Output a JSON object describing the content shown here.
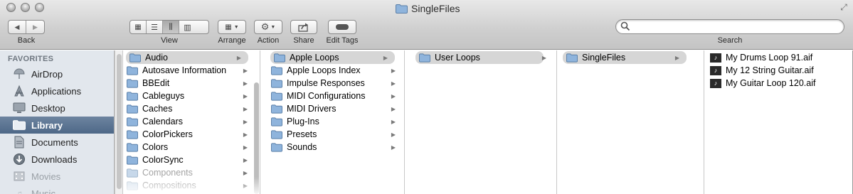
{
  "window": {
    "title": "SingleFiles"
  },
  "toolbar": {
    "back_label": "Back",
    "view_label": "View",
    "arrange_label": "Arrange",
    "action_label": "Action",
    "share_label": "Share",
    "edit_tags_label": "Edit Tags",
    "search_label": "Search",
    "search_value": ""
  },
  "sidebar": {
    "heading": "FAVORITES",
    "items": [
      {
        "label": "AirDrop",
        "icon": "airdrop-icon"
      },
      {
        "label": "Applications",
        "icon": "applications-icon"
      },
      {
        "label": "Desktop",
        "icon": "desktop-icon"
      },
      {
        "label": "Library",
        "icon": "folder-icon",
        "selected": true
      },
      {
        "label": "Documents",
        "icon": "documents-icon"
      },
      {
        "label": "Downloads",
        "icon": "downloads-icon"
      },
      {
        "label": "Movies",
        "icon": "movies-icon"
      },
      {
        "label": "Music",
        "icon": "music-icon"
      }
    ]
  },
  "columns": [
    {
      "items": [
        "Audio",
        "Autosave Information",
        "BBEdit",
        "Cableguys",
        "Caches",
        "Calendars",
        "ColorPickers",
        "Colors",
        "ColorSync",
        "Components",
        "Compositions"
      ],
      "selected": 0
    },
    {
      "items": [
        "Apple Loops",
        "Apple Loops Index",
        "Impulse Responses",
        "MIDI Configurations",
        "MIDI Drivers",
        "Plug-Ins",
        "Presets",
        "Sounds"
      ],
      "selected": 0
    },
    {
      "items": [
        "User Loops"
      ],
      "selected": 0
    },
    {
      "items": [
        "SingleFiles"
      ],
      "selected": 0
    },
    {
      "items": [
        "My Drums Loop 91.aif",
        "My 12 String Guitar.aif",
        "My Guitar Loop 120.aif"
      ]
    }
  ]
}
